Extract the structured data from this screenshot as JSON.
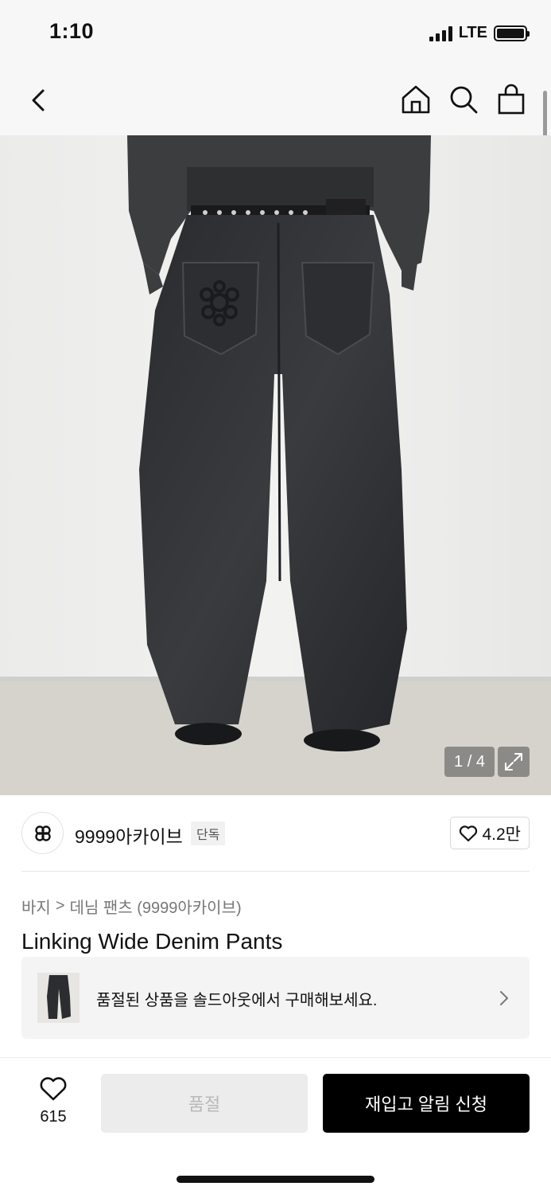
{
  "status": {
    "time": "1:10",
    "network": "LTE"
  },
  "nav": {
    "back_icon": "chevron-left-icon",
    "home_icon": "home-icon",
    "search_icon": "search-icon",
    "bag_icon": "shopping-bag-icon"
  },
  "gallery": {
    "counter": "1 / 4",
    "current_index": 1,
    "total": 4
  },
  "brand": {
    "name": "9999아카이브",
    "badge": "단독",
    "likes": "4.2만"
  },
  "breadcrumb": {
    "category": "바지",
    "separator": ">",
    "subcategory": "데님 팬츠 (9999아카이브)"
  },
  "product": {
    "title": "Linking Wide Denim Pants"
  },
  "soldout_banner": {
    "text": "품절된 상품을 솔드아웃에서 구매해보세요."
  },
  "actions": {
    "wish_count": "615",
    "soldout_label": "품절",
    "restock_label": "재입고 알림 신청"
  },
  "colors": {
    "primary_button": "#000000",
    "disabled_button": "#ececec",
    "header_bg": "#f7f7f7"
  }
}
